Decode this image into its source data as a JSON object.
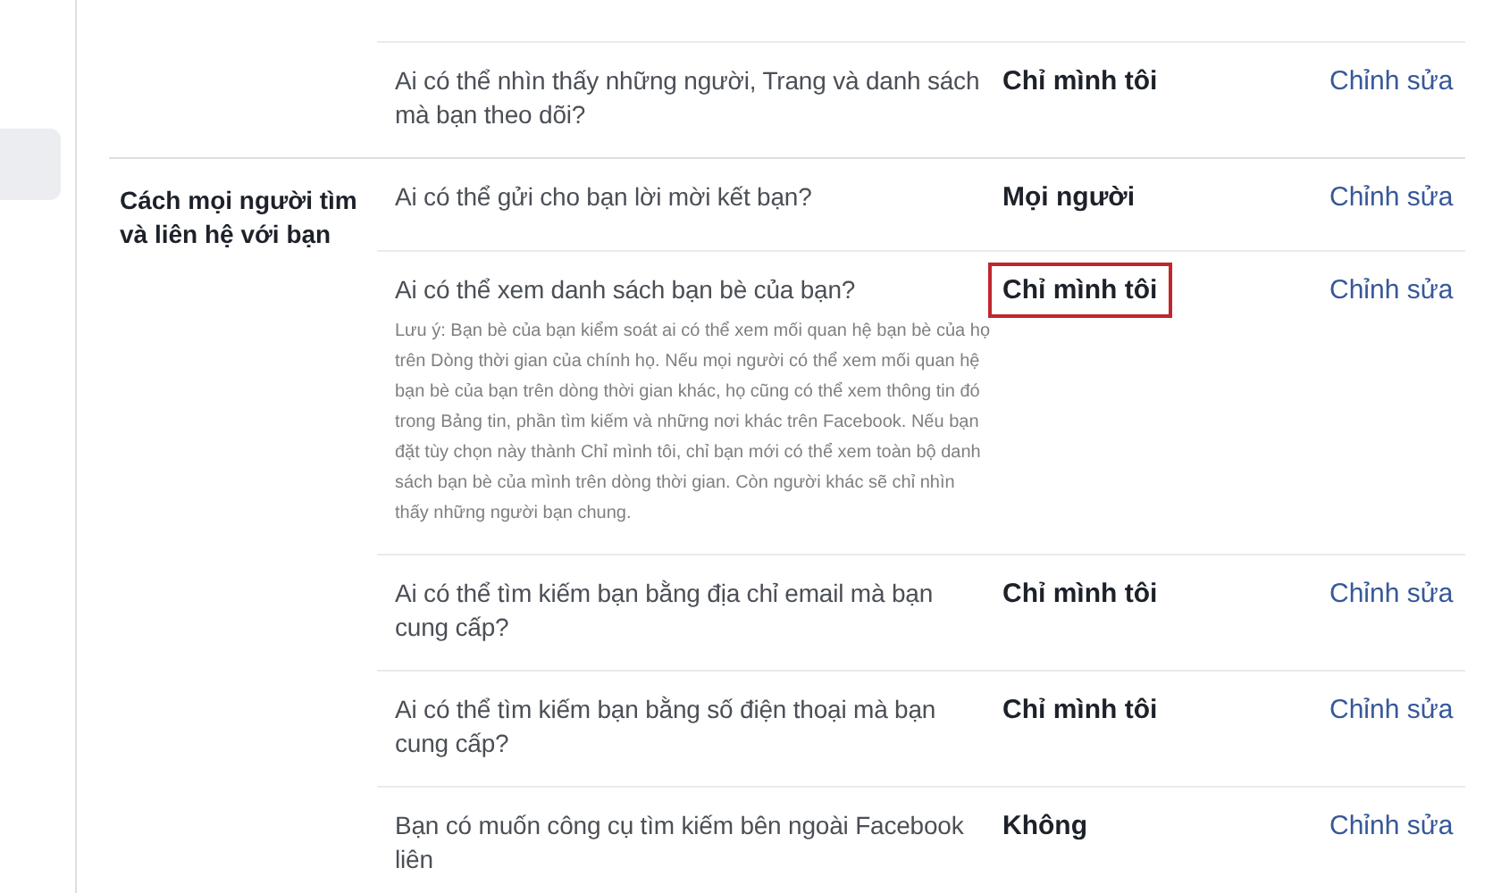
{
  "sidebar": {
    "items": [
      {
        "selected": true
      }
    ]
  },
  "sections": [
    {
      "rows": [
        {
          "question": "Ai có thể nhìn thấy những người, Trang và danh sách mà bạn theo dõi?",
          "value": "Chỉ mình tôi",
          "edit": "Chỉnh sửa",
          "highlighted": false
        }
      ]
    },
    {
      "label": "Cách mọi người tìm và liên hệ với bạn",
      "rows": [
        {
          "question": "Ai có thể gửi cho bạn lời mời kết bạn?",
          "value": "Mọi người",
          "edit": "Chỉnh sửa",
          "highlighted": false
        },
        {
          "question": "Ai có thể xem danh sách bạn bè của bạn?",
          "note": "Lưu ý: Bạn bè của bạn kiểm soát ai có thể xem mối quan hệ bạn bè của họ trên Dòng thời gian của chính họ. Nếu mọi người có thể xem mối quan hệ bạn bè của bạn trên dòng thời gian khác, họ cũng có thể xem thông tin đó trong Bảng tin, phần tìm kiếm và những nơi khác trên Facebook. Nếu bạn đặt tùy chọn này thành Chỉ mình tôi, chỉ bạn mới có thể xem toàn bộ danh sách bạn bè của mình trên dòng thời gian. Còn người khác sẽ chỉ nhìn thấy những người bạn chung.",
          "value": "Chỉ mình tôi",
          "edit": "Chỉnh sửa",
          "highlighted": true
        },
        {
          "question": "Ai có thể tìm kiếm bạn bằng địa chỉ email mà bạn cung cấp?",
          "value": "Chỉ mình tôi",
          "edit": "Chỉnh sửa",
          "highlighted": false
        },
        {
          "question": "Ai có thể tìm kiếm bạn bằng số điện thoại mà bạn cung cấp?",
          "value": "Chỉ mình tôi",
          "edit": "Chỉnh sửa",
          "highlighted": false
        },
        {
          "question": "Bạn có muốn công cụ tìm kiếm bên ngoài Facebook liên",
          "value": "Không",
          "edit": "Chỉnh sửa",
          "highlighted": false
        }
      ]
    }
  ]
}
